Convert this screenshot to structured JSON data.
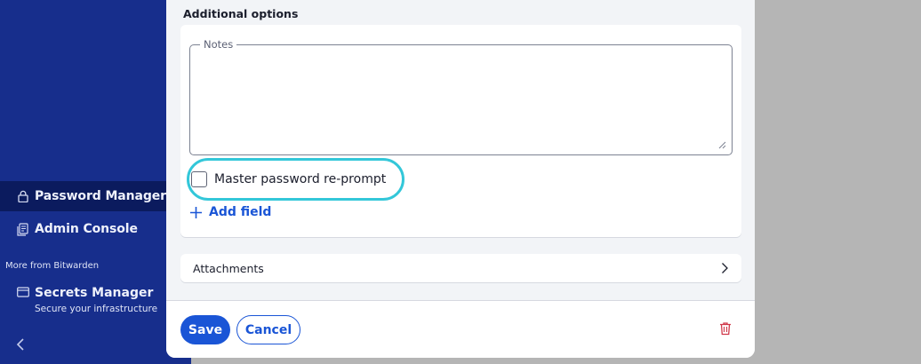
{
  "sidebar": {
    "items": [
      {
        "label": "Password Manager",
        "icon": "lock-icon",
        "active": true
      },
      {
        "label": "Admin Console",
        "icon": "admin-console-icon",
        "active": false
      }
    ],
    "more_heading": "More from Bitwarden",
    "secrets_manager": {
      "label": "Secrets Manager",
      "subtitle": "Secure your infrastructure",
      "icon": "secrets-manager-icon"
    },
    "collapse_icon": "chevron-left-icon"
  },
  "dialog": {
    "section_title": "Additional options",
    "notes": {
      "label": "Notes",
      "value": ""
    },
    "reprompt": {
      "label": "Master password re-prompt",
      "checked": false
    },
    "add_field": {
      "label": "Add field",
      "icon": "plus-icon"
    },
    "attachments": {
      "label": "Attachments",
      "icon": "chevron-right-icon"
    },
    "footer": {
      "save_label": "Save",
      "cancel_label": "Cancel",
      "delete_icon": "trash-icon"
    }
  },
  "colors": {
    "sidebar_bg": "#172e8c",
    "sidebar_active": "#0b1b5e",
    "accent": "#1a55d6",
    "highlight": "#33c7d9",
    "danger": "#d0384a"
  }
}
